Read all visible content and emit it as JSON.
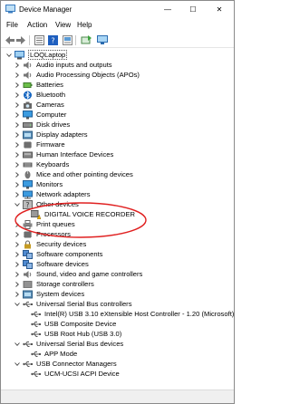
{
  "window": {
    "title": "Device Manager",
    "controls": {
      "minimize": "—",
      "maximize": "☐",
      "close": "✕"
    }
  },
  "menu": [
    "File",
    "Action",
    "View",
    "Help"
  ],
  "toolbar": [
    "back-icon",
    "forward-icon",
    "properties-icon",
    "help-icon",
    "action-icon",
    "monitor-icon"
  ],
  "tree": {
    "root": "LOQLaptop",
    "categories": [
      "Audio inputs and outputs",
      "Audio Processing Objects (APOs)",
      "Batteries",
      "Bluetooth",
      "Cameras",
      "Computer",
      "Disk drives",
      "Display adapters",
      "Firmware",
      "Human Interface Devices",
      "Keyboards",
      "Mice and other pointing devices",
      "Monitors",
      "Network adapters",
      "Other devices",
      "DIGITAL VOICE RECORDER",
      "Print queues",
      "Processors",
      "Security devices",
      "Software components",
      "Software devices",
      "Sound, video and game controllers",
      "Storage controllers",
      "System devices",
      "Universal Serial Bus controllers",
      "Intel(R) USB 3.10 eXtensible Host Controller - 1.20 (Microsoft)",
      "USB Composite Device",
      "USB Root Hub (USB 3.0)",
      "Universal Serial Bus devices",
      "APP Mode",
      "USB Connector Managers",
      "UCM-UCSI ACPI Device"
    ]
  },
  "colors": {
    "annotation": "#e02020",
    "warning": "#f2b200",
    "bluetooth": "#1565c0"
  }
}
